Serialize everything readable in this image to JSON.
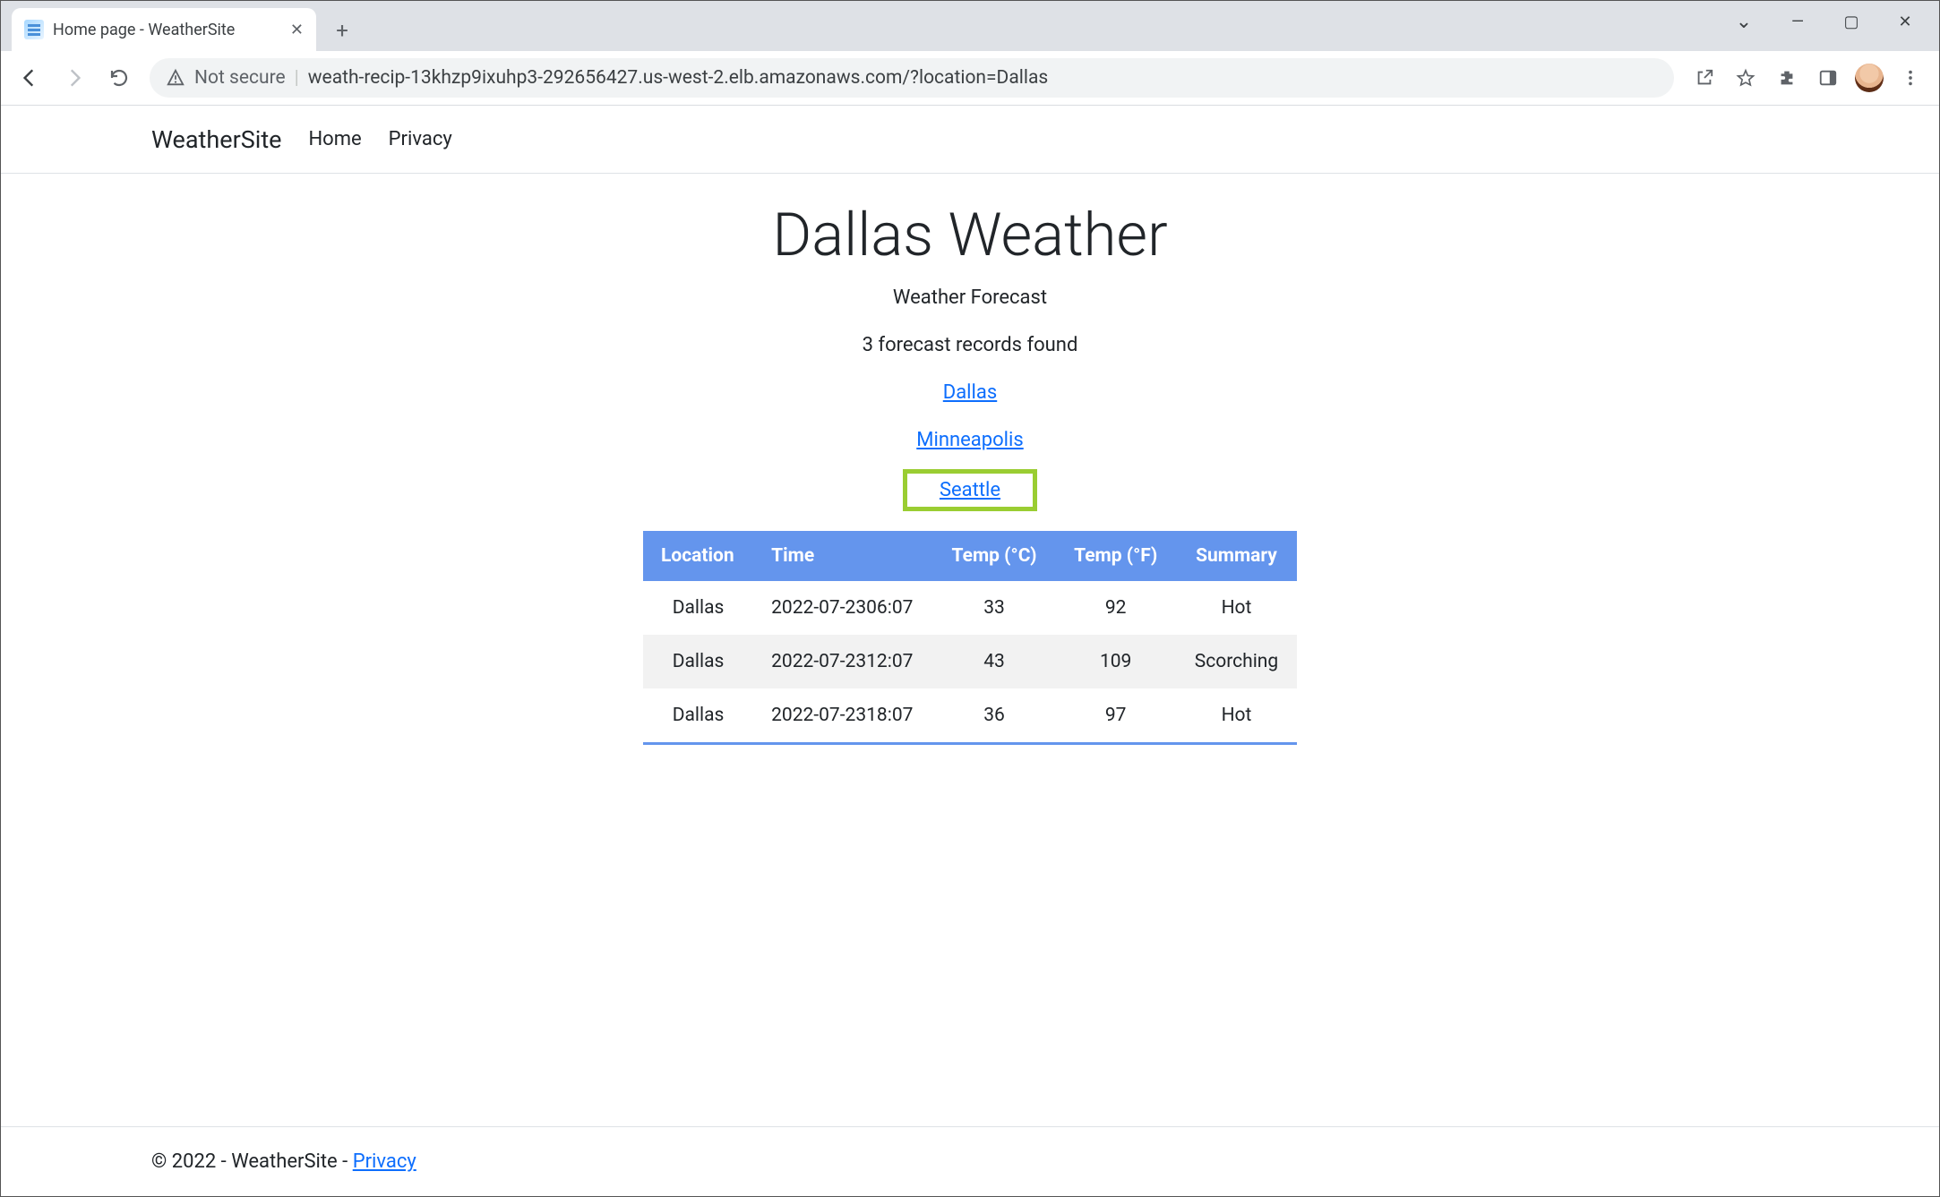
{
  "browser": {
    "tab_title": "Home page - WeatherSite",
    "not_secure_label": "Not secure",
    "url": "weath-recip-13khzp9ixuhp3-292656427.us-west-2.elb.amazonaws.com/?location=Dallas"
  },
  "nav": {
    "brand": "WeatherSite",
    "links": [
      "Home",
      "Privacy"
    ]
  },
  "main": {
    "heading": "Dallas Weather",
    "subtitle": "Weather Forecast",
    "records_found": "3 forecast records found",
    "location_links": [
      "Dallas",
      "Minneapolis",
      "Seattle"
    ],
    "highlighted_link_index": 2
  },
  "table": {
    "columns": [
      "Location",
      "Time",
      "Temp (°C)",
      "Temp (°F)",
      "Summary"
    ],
    "rows": [
      {
        "location": "Dallas",
        "time": "2022-07-2306:07",
        "temp_c": "33",
        "temp_f": "92",
        "summary": "Hot"
      },
      {
        "location": "Dallas",
        "time": "2022-07-2312:07",
        "temp_c": "43",
        "temp_f": "109",
        "summary": "Scorching"
      },
      {
        "location": "Dallas",
        "time": "2022-07-2318:07",
        "temp_c": "36",
        "temp_f": "97",
        "summary": "Hot"
      }
    ]
  },
  "footer": {
    "text_prefix": "© 2022 - WeatherSite - ",
    "privacy_label": "Privacy"
  }
}
